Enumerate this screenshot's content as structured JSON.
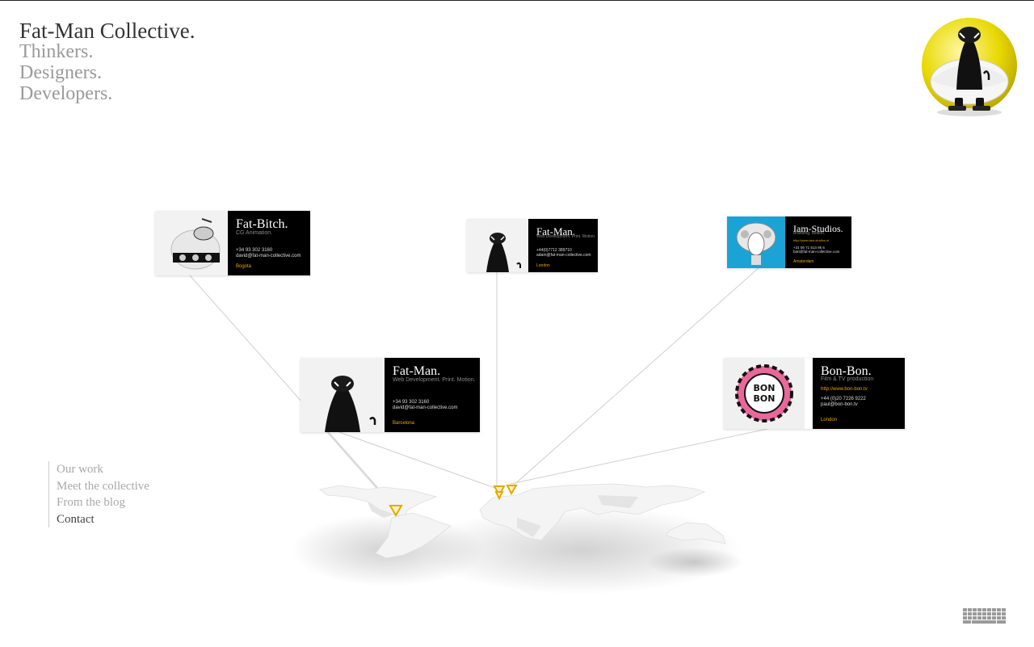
{
  "header": {
    "title": "Fat-Man Collective.",
    "taglines": [
      "Thinkers.",
      "Designers.",
      "Developers."
    ]
  },
  "logo": {
    "icon": "fatman-mascot-icon",
    "accent": "#e8d800"
  },
  "nav": {
    "items": [
      {
        "label": "Our work"
      },
      {
        "label": "Meet the collective"
      },
      {
        "label": "From the blog"
      },
      {
        "label": "Contact"
      }
    ]
  },
  "cards": [
    {
      "name": "Fat-Bitch.",
      "desc": "CG Animation.",
      "phone": "+34 93 302 3160",
      "email": "david@fat-man-collective.com",
      "url": "",
      "city": "Bogota"
    },
    {
      "name": "Fat-Man.",
      "desc": "Web Development. Print. Motion.",
      "phone": "+44(0)7712 389710",
      "email": "adam@fat-man-collective.com",
      "url": "",
      "city": "London"
    },
    {
      "name": "Iam-Studios.",
      "desc": "Branding. Motion.",
      "phone": "+31 06 71 513 95 6",
      "email": "bart@fat-man-collective.com",
      "url": "http://www.iam-studios.nl",
      "city": "Amsterdam"
    },
    {
      "name": "Fat-Man.",
      "desc": "Web Development. Print. Motion.",
      "phone": "+34 93 302 3160",
      "email": "david@fat-man-collective.com",
      "url": "",
      "city": "Barcelona"
    },
    {
      "name": "Bon-Bon.",
      "desc": "Film & TV production",
      "phone": "+44 (0)20 7226 9222",
      "email": "paul@bon-bon.tv",
      "url": "http://www.bon-bon.tv",
      "city": "London"
    }
  ],
  "colors": {
    "accent": "#e7a800",
    "card_bg": "#000000",
    "text_muted": "#9a9a9a"
  },
  "footer": {
    "icon": "keyboard-icon"
  }
}
